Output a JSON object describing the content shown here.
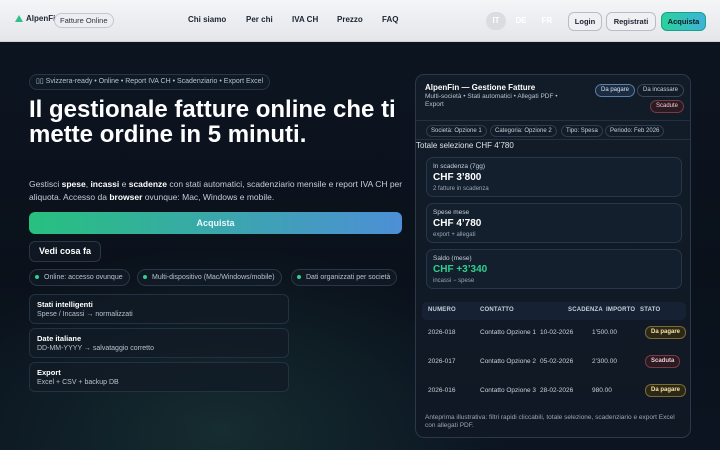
{
  "header": {
    "brand": "AlpenFin",
    "pill": "Fatture Online",
    "nav": [
      "Chi siamo",
      "Per chi",
      "IVA CH",
      "Prezzo",
      "FAQ"
    ],
    "langs": [
      "IT",
      "DE",
      "FR"
    ],
    "login": "Login",
    "register": "Registrati",
    "buy": "Acquista"
  },
  "hero": {
    "chip": "▯▯ Svizzera-ready • Online • Report IVA CH • Scadenziario • Export Excel",
    "title": "Il gestionale fatture online che ti mette ordine in 5 minuti.",
    "sub_1": "Gestisci ",
    "sub_b1": "spese",
    "sub_2": ", ",
    "sub_b2": "incassi",
    "sub_3": " e ",
    "sub_b3": "scadenze",
    "sub_4": " con stati automatici, scadenziario mensile e report IVA CH per aliquota. Accesso da ",
    "sub_b4": "browser",
    "sub_5": " ovunque: Mac, Windows e mobile.",
    "cta": "Acquista",
    "ghost": "Vedi cosa fa",
    "features": [
      "Online: accesso ovunque",
      "Multi-dispositivo (Mac/Windows/mobile)",
      "Dati organizzati per società"
    ],
    "cards": [
      {
        "title": "Stati intelligenti",
        "desc": "Spese / Incassi → normalizzati"
      },
      {
        "title": "Date italiane",
        "desc": "DD-MM-YYYY → salvataggio corretto"
      },
      {
        "title": "Export",
        "desc": "Excel + CSV + backup DB"
      }
    ]
  },
  "panel": {
    "title": "AlpenFin — Gestione Fatture",
    "sub": "Multi-società • Stati automatici • Allegati PDF • Export",
    "badges": [
      "Da pagare",
      "Da incassare",
      "Scadute"
    ],
    "filters": [
      "Società: Opzione 1",
      "Categoria: Opzione 2",
      "Tipo: Spesa",
      "Periodo: Feb 2026"
    ],
    "total": "Totale selezione CHF 4’780",
    "stats": [
      {
        "label": "In scadenza (7gg)",
        "value": "CHF 3’800",
        "note": "2 fatture in scadenza"
      },
      {
        "label": "Spese mese",
        "value": "CHF 4’780",
        "note": "export + allegati"
      },
      {
        "label": "Saldo (mese)",
        "value": "CHF +3’340",
        "note": "incassi − spese"
      }
    ],
    "columns": [
      "NUMERO",
      "CONTATTO",
      "SCADENZA",
      "IMPORTO",
      "STATO"
    ],
    "rows": [
      {
        "num": "2026-018",
        "contact": "Contatto Opzione 1",
        "due": "10-02-2026",
        "amount": "1’500.00",
        "status": "Da pagare"
      },
      {
        "num": "2026-017",
        "contact": "Contatto Opzione 2",
        "due": "05-02-2026",
        "amount": "2’300.00",
        "status": "Scaduta"
      },
      {
        "num": "2026-016",
        "contact": "Contatto Opzione 3",
        "due": "28-02-2026",
        "amount": "980.00",
        "status": "Da pagare"
      }
    ],
    "footnote": "Anteprima illustrativa: filtri rapidi cliccabili, totale selezione, scadenziario e export Excel con allegati PDF."
  }
}
